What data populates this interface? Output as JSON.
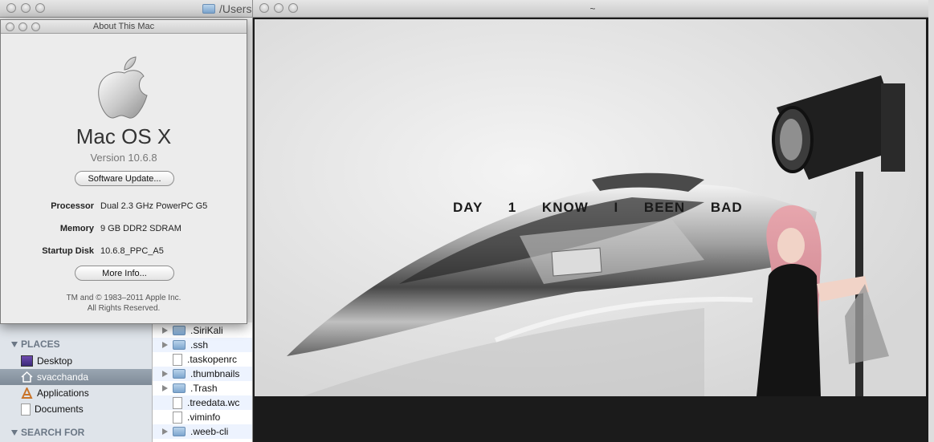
{
  "finder": {
    "path_title": "/Users",
    "clipped_item": "",
    "sidebar": {
      "places_header": "PLACES",
      "search_header": "SEARCH FOR",
      "items": [
        {
          "label": "Desktop",
          "icon": "desktop-icon",
          "selected": false
        },
        {
          "label": "svacchanda",
          "icon": "home-icon",
          "selected": true
        },
        {
          "label": "Applications",
          "icon": "applications-icon",
          "selected": false
        },
        {
          "label": "Documents",
          "icon": "documents-icon",
          "selected": false
        }
      ]
    },
    "files": [
      {
        "name": ".SiriKali",
        "type": "folder"
      },
      {
        "name": ".ssh",
        "type": "folder"
      },
      {
        "name": ".taskopenrc",
        "type": "file"
      },
      {
        "name": ".thumbnails",
        "type": "folder"
      },
      {
        "name": ".Trash",
        "type": "folder"
      },
      {
        "name": ".treedata.wc",
        "type": "file"
      },
      {
        "name": ".viminfo",
        "type": "file"
      },
      {
        "name": ".weeb-cli",
        "type": "folder"
      }
    ]
  },
  "about_mac": {
    "window_title": "About This Mac",
    "os_name": "Mac OS X",
    "version": "Version 10.6.8",
    "software_update_label": "Software Update...",
    "specs": [
      {
        "label": "Processor",
        "value": "Dual 2.3 GHz PowerPC G5"
      },
      {
        "label": "Memory",
        "value": "9 GB DDR2 SDRAM"
      },
      {
        "label": "Startup Disk",
        "value": "10.6.8_PPC_A5"
      }
    ],
    "more_info_label": "More Info...",
    "copyright_line1": "TM and © 1983–2011 Apple Inc.",
    "copyright_line2": "All Rights Reserved."
  },
  "video_window": {
    "title": "~",
    "lyrics": "DAY 1 KNOW I BEEN BAD"
  }
}
